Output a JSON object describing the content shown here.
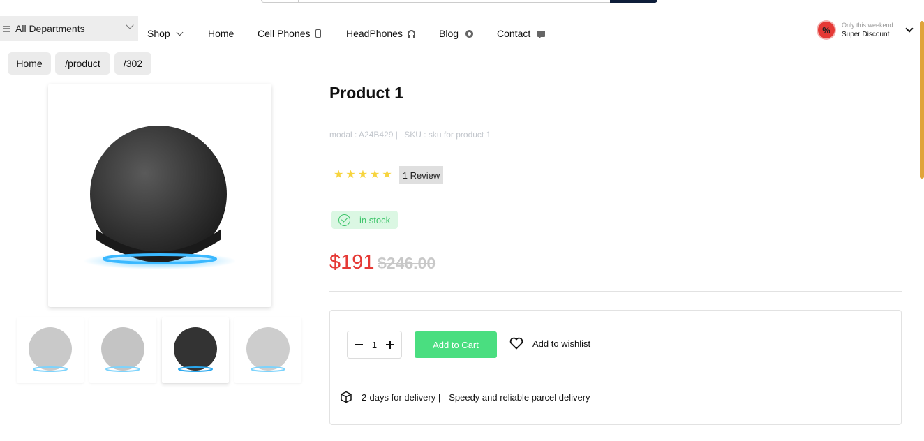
{
  "nav": {
    "departments_label": "All Departments",
    "items": [
      {
        "label": "Shop"
      },
      {
        "label": "Home"
      },
      {
        "label": "Cell Phones"
      },
      {
        "label": "HeadPhones"
      },
      {
        "label": "Blog"
      },
      {
        "label": "Contact"
      }
    ],
    "promo": {
      "line1": "Only this weekend",
      "line2": "Super Discount",
      "badge": "%"
    }
  },
  "breadcrumb": [
    "Home",
    "/product",
    "/302"
  ],
  "product": {
    "title": "Product 1",
    "model": "modal : A24B429 |",
    "sku": "SKU : sku for product 1",
    "rating": 5,
    "review_label": "1 Review",
    "stock_label": "in stock",
    "price": "$191",
    "old_price": "$246.00",
    "quantity": "1",
    "add_to_cart": "Add to Cart",
    "wishlist": "Add to wishlist",
    "delivery_days": "2-days for delivery |",
    "delivery_text": "Speedy and reliable parcel delivery"
  },
  "gallery": {
    "thumbnails": [
      "light-speaker",
      "light-speaker",
      "dark-speaker",
      "light-speaker"
    ],
    "active_index": 2
  },
  "colors": {
    "price": "#e53935",
    "add_to_cart": "#4ade80",
    "stock": "#3ec56a",
    "star": "#f7d43e"
  }
}
